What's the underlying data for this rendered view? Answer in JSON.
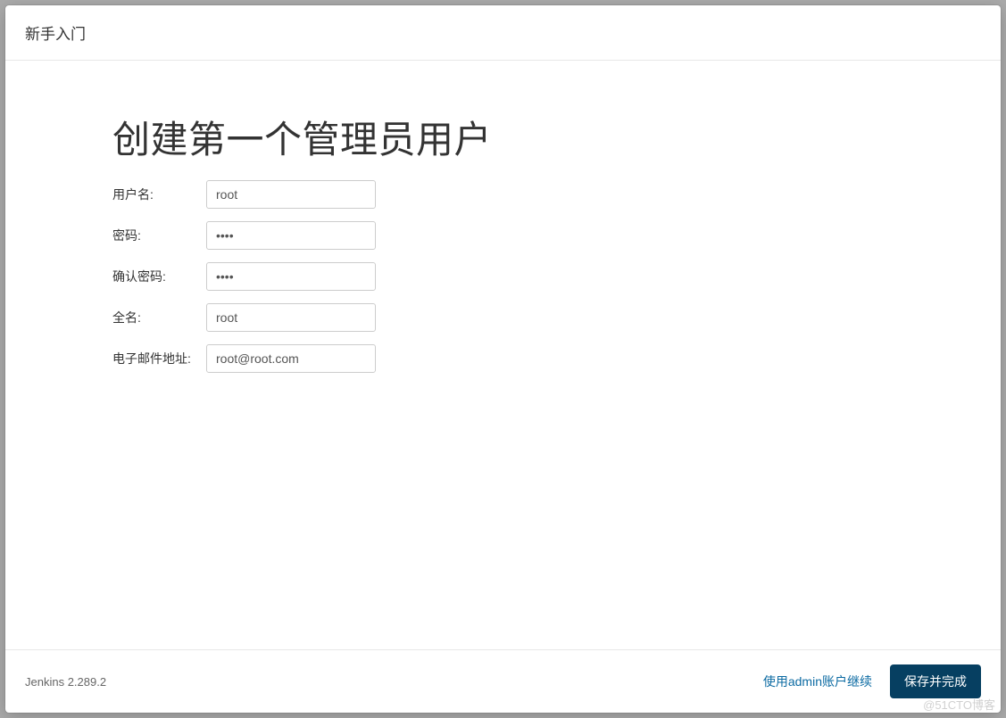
{
  "header": {
    "title": "新手入门"
  },
  "main": {
    "title": "创建第一个管理员用户",
    "form": {
      "username": {
        "label": "用户名:",
        "value": "root"
      },
      "password": {
        "label": "密码:",
        "value": "••••"
      },
      "confirm_password": {
        "label": "确认密码:",
        "value": "••••"
      },
      "fullname": {
        "label": "全名:",
        "value": "root"
      },
      "email": {
        "label": "电子邮件地址:",
        "value": "root@root.com"
      }
    }
  },
  "footer": {
    "version": "Jenkins 2.289.2",
    "continue_as_admin": "使用admin账户继续",
    "save_and_finish": "保存并完成"
  },
  "watermark": "@51CTO博客"
}
